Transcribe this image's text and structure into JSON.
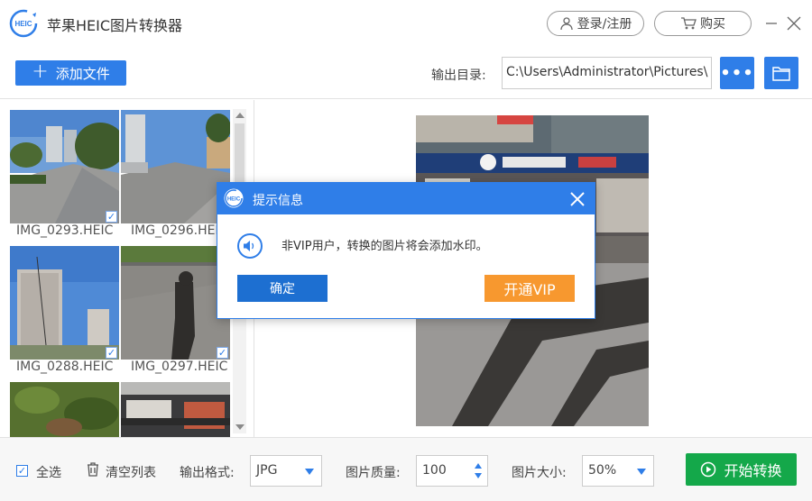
{
  "app": {
    "title": "苹果HEIC图片转换器",
    "logo_text": "HEIC",
    "login_label": "登录/注册",
    "buy_label": "购买"
  },
  "toolbar": {
    "add_file_label": "添加文件",
    "output_dir_label": "输出目录:",
    "output_dir_value": "C:\\Users\\Administrator\\Pictures\\",
    "more_label": "•••"
  },
  "files": [
    {
      "name": "IMG_0293.HEIC",
      "checked": true
    },
    {
      "name": "IMG_0296.HEIC",
      "checked": true
    },
    {
      "name": "IMG_0288.HEIC",
      "checked": true
    },
    {
      "name": "IMG_0297.HEIC",
      "checked": true
    },
    {
      "name": "",
      "checked": false
    },
    {
      "name": "",
      "checked": false
    }
  ],
  "bottom": {
    "select_all_label": "全选",
    "clear_list_label": "清空列表",
    "format_label": "输出格式:",
    "format_value": "JPG",
    "quality_label": "图片质量:",
    "quality_value": "100",
    "size_label": "图片大小:",
    "size_value": "50%",
    "start_label": "开始转换"
  },
  "dialog": {
    "title": "提示信息",
    "message": "非VIP用户，转换的图片将会添加水印。",
    "ok_label": "确定",
    "vip_label": "开通VIP"
  },
  "colors": {
    "accent": "#2f7ee8",
    "start_green": "#14a84a",
    "vip_orange": "#f7982f"
  }
}
